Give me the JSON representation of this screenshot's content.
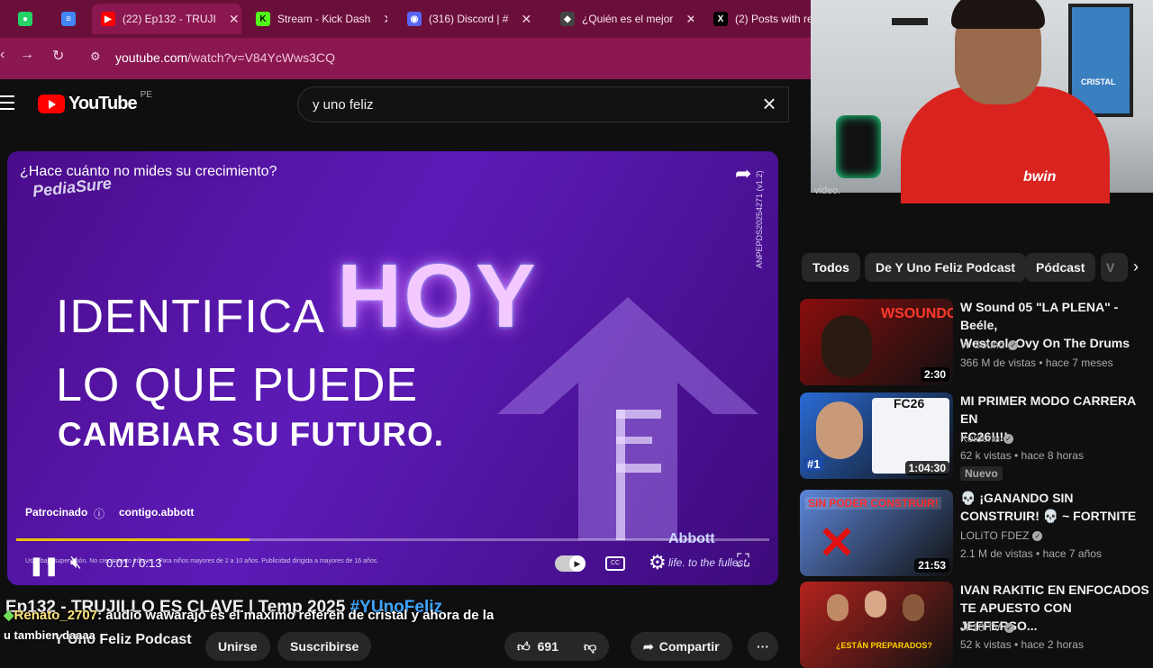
{
  "browser": {
    "tabs": [
      {
        "label": "",
        "icon": "whatsapp-icon"
      },
      {
        "label": "",
        "icon": "docs-icon"
      },
      {
        "label": "(22) Ep132 - TRUJI",
        "icon": "youtube-icon"
      },
      {
        "label": "Stream - Kick Dash",
        "icon": "kick-icon"
      },
      {
        "label": "(316) Discord | #",
        "icon": "discord-icon"
      },
      {
        "label": "¿Quién es el mejor",
        "icon": "site-icon"
      },
      {
        "label": "(2) Posts with re",
        "icon": "x-icon"
      }
    ],
    "url_domain": "youtube.com",
    "url_path": "/watch?v=V84YcWws3CQ"
  },
  "youtube": {
    "logo_word": "YouTube",
    "country_code": "PE",
    "search_value": "y uno feliz"
  },
  "ad": {
    "question": "¿Hace cuánto no mides su crecimiento?",
    "brand": "PediaSure",
    "legal_code": "ANPEPDS20254271 (v1.2)",
    "line1": "IDENTIFICA",
    "highlight": "HOY",
    "line2": "LO QUE PUEDE",
    "line3": "CAMBIAR SU FUTURO.",
    "sponsored_label": "Patrocinado",
    "advertiser_domain": "contigo.abbott",
    "advertiser_logo": "Abbott",
    "advertiser_tagline": "life. to the fullest",
    "fine_print": "Usar bajo supervisión. No crecimiento influye... Para niños mayores de 2 a 10 años. Publicidad dirigida a mayores de 16 años.",
    "time": "0:01 / 0:13",
    "progress": 0.31
  },
  "video": {
    "title": "Ep132 - TRUJILLO ES CLAVE | Temp 2025 ",
    "hashtag": "#YUnoFeliz",
    "channel": "Y Uno Feliz Podcast",
    "join_label": "Unirse",
    "subscribe_label": "Suscribirse",
    "likes": "691",
    "share_label": "Compartir",
    "more_label": "···"
  },
  "chat_overlay": {
    "user": "Renato_2707",
    "message": ": audio wawarajo es el maximo referen de cristal y ahora de la",
    "message_cont": "u tambien daaaa"
  },
  "webcam": {
    "shirt_sponsor": "bwin",
    "poster_text": "CRISTAL",
    "partial_label": "video."
  },
  "chips": [
    "Todos",
    "De Y Uno Feliz Podcast",
    "Pódcast",
    "V"
  ],
  "recommendations": [
    {
      "title_line1": "W Sound 05 \"LA PLENA\" - Beéle,",
      "title_line2": "Westcol, Ovy On The Drums",
      "channel": "W Sound",
      "meta": "366 M de vistas • hace 7 meses",
      "duration": "2:30",
      "thumb_text": "WSOUNDOS",
      "thumb_color": "#8a0d0d"
    },
    {
      "title_line1": "MI PRIMER MODO CARRERA EN",
      "title_line2": "FC26!!!!",
      "channel": "Kolderiu",
      "meta": "62 k vistas • hace 8 horas",
      "duration": "1:04:30",
      "badge": "Nuevo",
      "thumb_text": "FC26",
      "rank": "#1",
      "thumb_color": "#2a6bd6"
    },
    {
      "title_line1": "💀 ¡GANANDO SIN",
      "title_line2": "CONSTRUIR! 💀 ~ FORTNITE",
      "channel": "LOLiTO FDEZ",
      "meta": "2.1 M de vistas • hace 7 años",
      "duration": "21:53",
      "thumb_text": "SIN PODER CONSTRUIR!",
      "thumb_color": "#5d86d9"
    },
    {
      "title_line1": "IVAN RAKITIC EN ENFOCADOS",
      "title_line2": "TE APUESTO CON JEFFERSO...",
      "channel": "JF10 TV",
      "meta": "52 k vistas • hace 2 horas",
      "thumb_text": "¿ESTÁN PREPARADOS?",
      "thumb_color": "#b3231d"
    }
  ]
}
